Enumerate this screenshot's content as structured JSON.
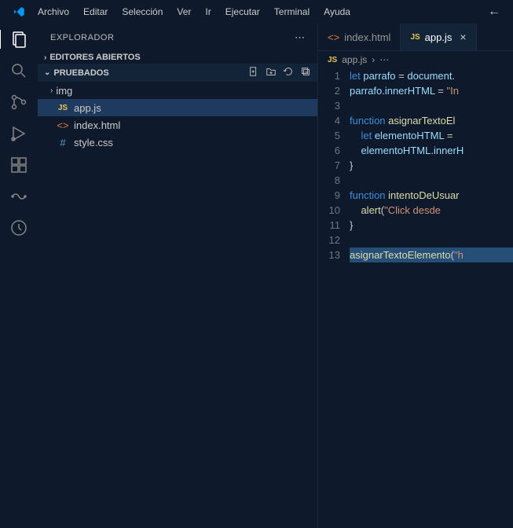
{
  "menu": [
    "Archivo",
    "Editar",
    "Selección",
    "Ver",
    "Ir",
    "Ejecutar",
    "Terminal",
    "Ayuda"
  ],
  "sidebar": {
    "title": "EXPLORADOR",
    "sections": {
      "openEditors": "EDITORES ABIERTOS",
      "root": "PRUEBADOS"
    },
    "items": [
      {
        "type": "folder",
        "label": "img"
      },
      {
        "type": "file",
        "label": "app.js",
        "icon": "js",
        "active": true
      },
      {
        "type": "file",
        "label": "index.html",
        "icon": "html"
      },
      {
        "type": "file",
        "label": "style.css",
        "icon": "css"
      }
    ]
  },
  "tabs": [
    {
      "label": "index.html",
      "icon": "html",
      "active": false
    },
    {
      "label": "app.js",
      "icon": "js",
      "active": true
    }
  ],
  "breadcrumb": {
    "icon": "js",
    "file": "app.js"
  },
  "code": {
    "lines": [
      {
        "n": 1,
        "tokens": [
          [
            "kw",
            "let"
          ],
          [
            "",
            ""
          ],
          [
            "var",
            " parrafo"
          ],
          [
            "punct",
            " = "
          ],
          [
            "var",
            "document"
          ],
          [
            "punct",
            "."
          ]
        ]
      },
      {
        "n": 2,
        "tokens": [
          [
            "var",
            "parrafo"
          ],
          [
            "punct",
            "."
          ],
          [
            "var",
            "innerHTML"
          ],
          [
            "punct",
            " = "
          ],
          [
            "str",
            "\"In"
          ]
        ]
      },
      {
        "n": 3,
        "tokens": []
      },
      {
        "n": 4,
        "tokens": [
          [
            "kw",
            "function"
          ],
          [
            "",
            " "
          ],
          [
            "fn",
            "asignarTextoEl"
          ]
        ]
      },
      {
        "n": 5,
        "tokens": [
          [
            "",
            "    "
          ],
          [
            "kw",
            "let"
          ],
          [
            "",
            " "
          ],
          [
            "var",
            "elementoHTML"
          ],
          [
            "punct",
            " = "
          ]
        ]
      },
      {
        "n": 6,
        "tokens": [
          [
            "",
            "    "
          ],
          [
            "var",
            "elementoHTML"
          ],
          [
            "punct",
            "."
          ],
          [
            "var",
            "innerH"
          ]
        ]
      },
      {
        "n": 7,
        "tokens": [
          [
            "punct",
            "}"
          ]
        ]
      },
      {
        "n": 8,
        "tokens": []
      },
      {
        "n": 9,
        "tokens": [
          [
            "kw",
            "function"
          ],
          [
            "",
            " "
          ],
          [
            "fn",
            "intentoDeUsuar"
          ]
        ]
      },
      {
        "n": 10,
        "tokens": [
          [
            "",
            "    "
          ],
          [
            "fn",
            "alert"
          ],
          [
            "punct",
            "("
          ],
          [
            "str",
            "\"Click desde "
          ]
        ]
      },
      {
        "n": 11,
        "tokens": [
          [
            "punct",
            "}"
          ]
        ]
      },
      {
        "n": 12,
        "tokens": []
      },
      {
        "n": 13,
        "tokens": [
          [
            "fn",
            "asignarTextoElemento"
          ],
          [
            "punct",
            "("
          ],
          [
            "str",
            "\"h"
          ]
        ],
        "hl": true
      }
    ]
  }
}
